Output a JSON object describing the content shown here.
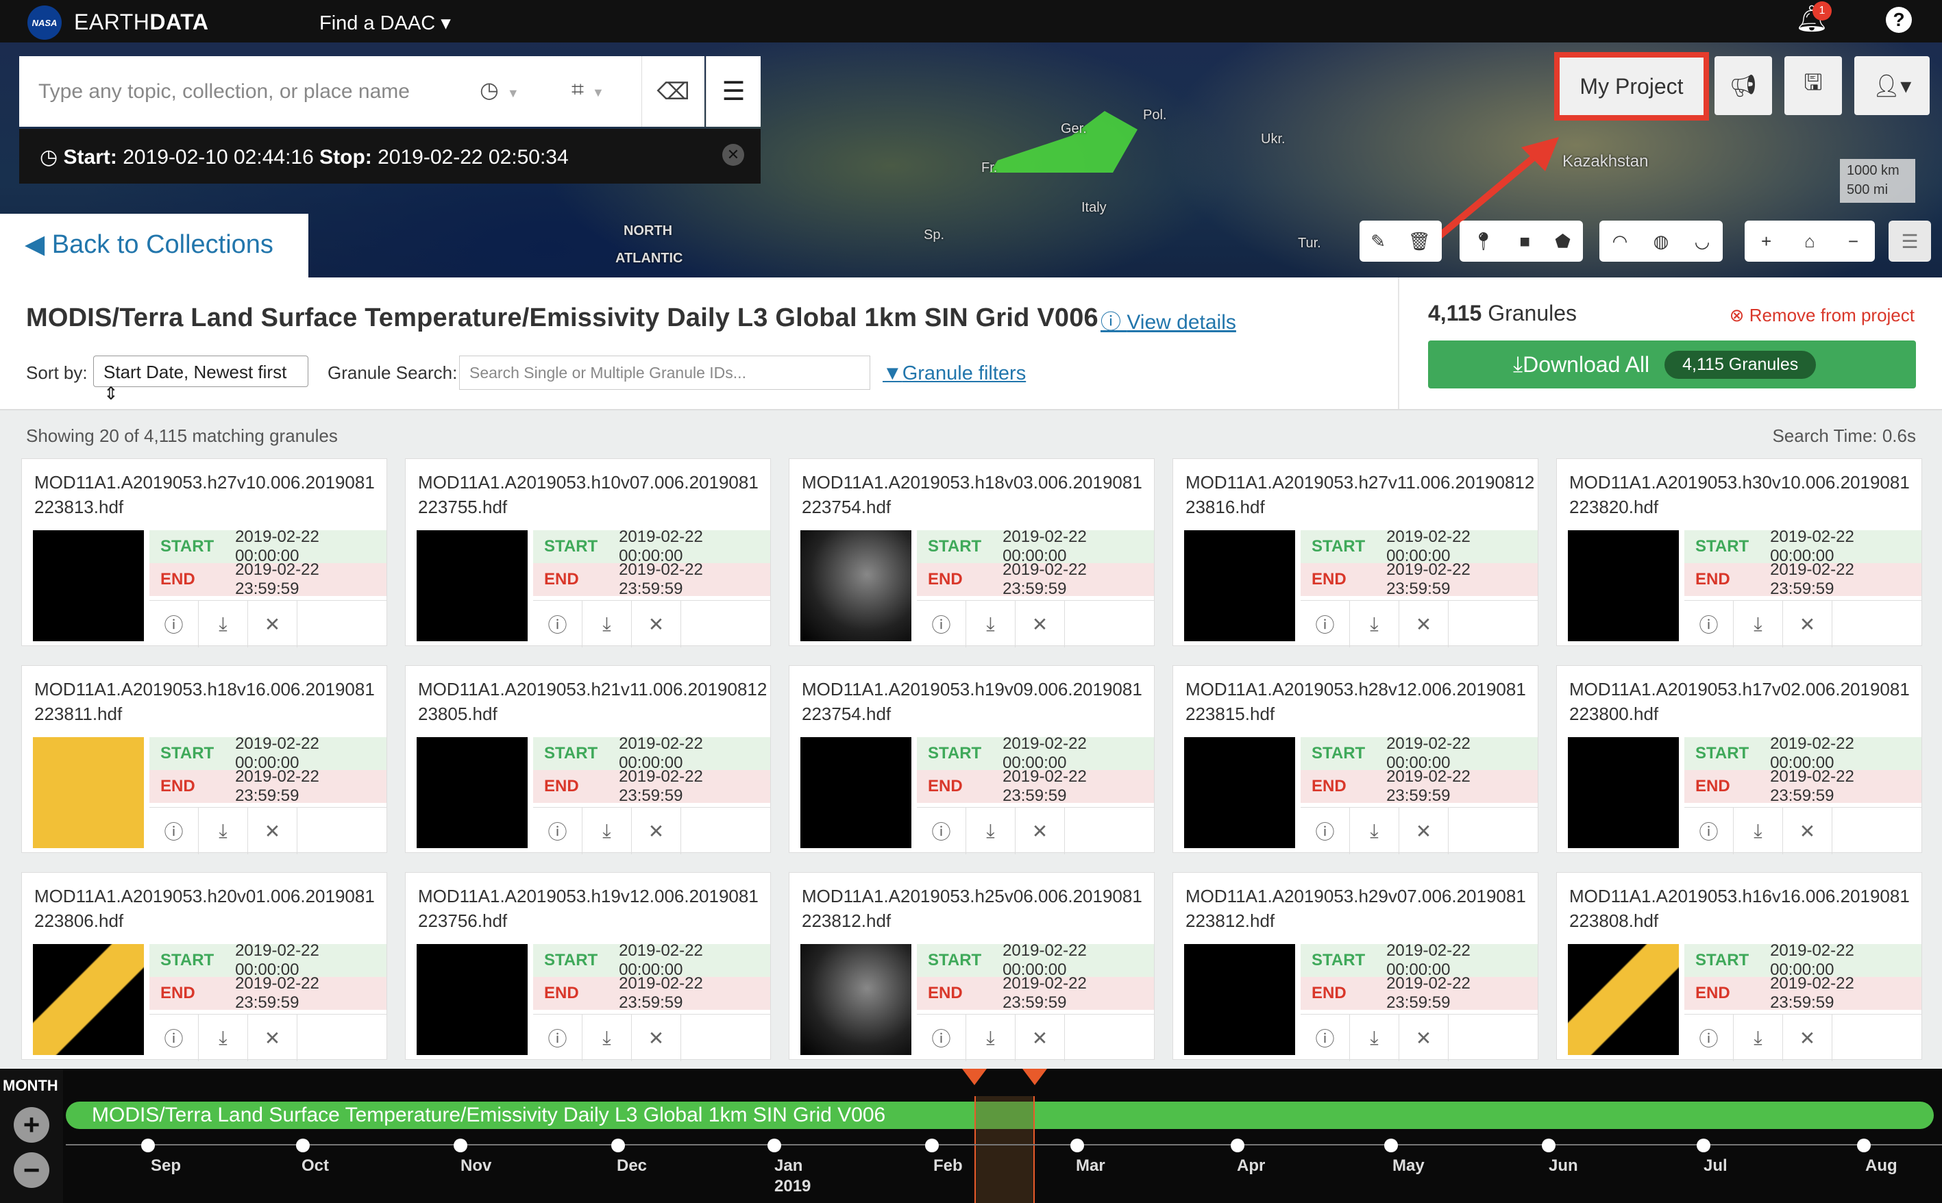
{
  "topnav": {
    "brand_light": "EARTH",
    "brand_bold": "DATA",
    "nasa": "NASA",
    "find_daac": "Find a DAAC ▾",
    "notifications": "1",
    "help": "?"
  },
  "search": {
    "placeholder": "Type any topic, collection, or place name"
  },
  "temporal": {
    "start_label": "Start:",
    "start": "2019-02-10 02:44:16",
    "stop_label": "Stop:",
    "stop": "2019-02-22 02:50:34"
  },
  "nav": {
    "back": "Back to Collections"
  },
  "map": {
    "labels": {
      "kazakhstan": "Kazakhstan",
      "pol": "Pol.",
      "ukr": "Ukr.",
      "fr": "Fr.",
      "italy": "Italy",
      "sp": "Sp.",
      "tur": "Tur.",
      "north": "NORTH",
      "atlantic": "ATLANTIC",
      "ger": "Ger."
    },
    "scale_km": "1000 km",
    "scale_mi": "500 mi"
  },
  "project": {
    "my_project": "My Project"
  },
  "collection": {
    "title": "MODIS/Terra Land Surface Temperature/Emissivity Daily L3 Global 1km SIN Grid V006",
    "view_details": "View details",
    "sort_label": "Sort by:",
    "sort_value": "Start Date, Newest first",
    "granule_search_label": "Granule Search:",
    "granule_search_placeholder": "Search Single or Multiple Granule IDs...",
    "granule_filters": "Granule filters"
  },
  "side": {
    "count_num": "4,115",
    "count_label": "Granules",
    "remove": "Remove from project",
    "download": "Download All",
    "download_badge": "4,115 Granules"
  },
  "list": {
    "showing": "Showing 20 of 4,115 matching granules",
    "search_time": "Search Time: 0.6s",
    "start_label": "START",
    "end_label": "END"
  },
  "granules": [
    {
      "name": "MOD11A1.A2019053.h27v10.006.2019081223813.hdf",
      "start": "2019-02-22 00:00:00",
      "end": "2019-02-22 23:59:59"
    },
    {
      "name": "MOD11A1.A2019053.h10v07.006.2019081223755.hdf",
      "start": "2019-02-22 00:00:00",
      "end": "2019-02-22 23:59:59"
    },
    {
      "name": "MOD11A1.A2019053.h18v03.006.2019081223754.hdf",
      "start": "2019-02-22 00:00:00",
      "end": "2019-02-22 23:59:59"
    },
    {
      "name": "MOD11A1.A2019053.h27v11.006.2019081223816.hdf",
      "start": "2019-02-22 00:00:00",
      "end": "2019-02-22 23:59:59"
    },
    {
      "name": "MOD11A1.A2019053.h30v10.006.2019081223820.hdf",
      "start": "2019-02-22 00:00:00",
      "end": "2019-02-22 23:59:59"
    },
    {
      "name": "MOD11A1.A2019053.h18v16.006.2019081223811.hdf",
      "start": "2019-02-22 00:00:00",
      "end": "2019-02-22 23:59:59"
    },
    {
      "name": "MOD11A1.A2019053.h21v11.006.2019081223805.hdf",
      "start": "2019-02-22 00:00:00",
      "end": "2019-02-22 23:59:59"
    },
    {
      "name": "MOD11A1.A2019053.h19v09.006.2019081223754.hdf",
      "start": "2019-02-22 00:00:00",
      "end": "2019-02-22 23:59:59"
    },
    {
      "name": "MOD11A1.A2019053.h28v12.006.2019081223815.hdf",
      "start": "2019-02-22 00:00:00",
      "end": "2019-02-22 23:59:59"
    },
    {
      "name": "MOD11A1.A2019053.h17v02.006.2019081223800.hdf",
      "start": "2019-02-22 00:00:00",
      "end": "2019-02-22 23:59:59"
    },
    {
      "name": "MOD11A1.A2019053.h20v01.006.2019081223806.hdf",
      "start": "2019-02-22 00:00:00",
      "end": "2019-02-22 23:59:59"
    },
    {
      "name": "MOD11A1.A2019053.h19v12.006.2019081223756.hdf",
      "start": "2019-02-22 00:00:00",
      "end": "2019-02-22 23:59:59"
    },
    {
      "name": "MOD11A1.A2019053.h25v06.006.2019081223812.hdf",
      "start": "2019-02-22 00:00:00",
      "end": "2019-02-22 23:59:59"
    },
    {
      "name": "MOD11A1.A2019053.h29v07.006.2019081223812.hdf",
      "start": "2019-02-22 00:00:00",
      "end": "2019-02-22 23:59:59"
    },
    {
      "name": "MOD11A1.A2019053.h16v16.006.2019081223808.hdf",
      "start": "2019-02-22 00:00:00",
      "end": "2019-02-22 23:59:59"
    }
  ],
  "timeline": {
    "unit": "MONTH",
    "bar_label": "MODIS/Terra Land Surface Temperature/Emissivity Daily L3 Global 1km SIN Grid V006",
    "months": [
      "Sep",
      "Oct",
      "Nov",
      "Dec",
      "Jan",
      "Feb",
      "Mar",
      "Apr",
      "May",
      "Jun",
      "Jul",
      "Aug"
    ],
    "year": "2019"
  },
  "colors": {
    "accent_blue": "#2276ac",
    "green": "#3fa95a",
    "red": "#d9372a",
    "highlight": "#e53b2c"
  }
}
